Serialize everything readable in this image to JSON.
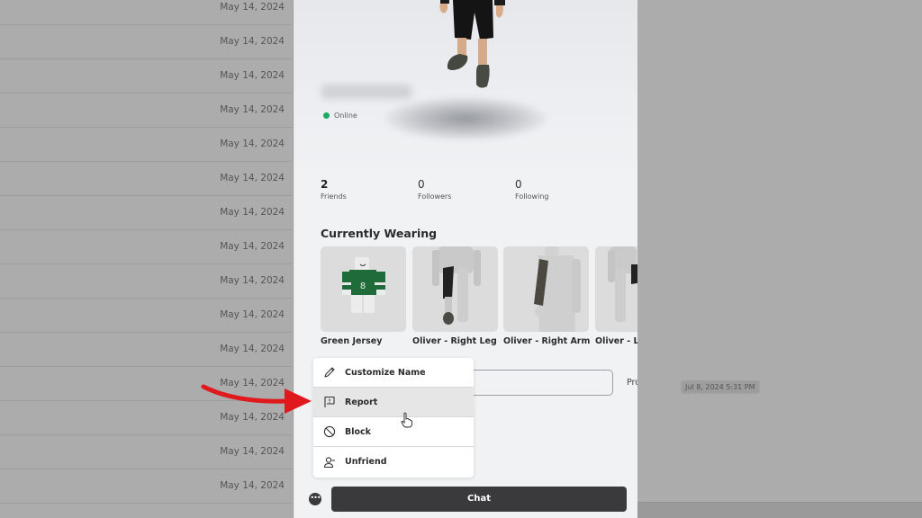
{
  "background_list": {
    "dates": [
      "May 14, 2024",
      "May 14, 2024",
      "May 14, 2024",
      "May 14, 2024",
      "May 14, 2024",
      "May 14, 2024",
      "May 14, 2024",
      "May 14, 2024",
      "May 14, 2024",
      "May 14, 2024",
      "May 14, 2024",
      "May 14, 2024",
      "May 14, 2024",
      "May 14, 2024",
      "May 14, 2024"
    ]
  },
  "timestamp_tooltip": "Jul 8, 2024 5:31 PM",
  "profile": {
    "status": "Online",
    "status_color": "#1fa865",
    "stats": [
      {
        "value": "2",
        "label": "Friends"
      },
      {
        "value": "0",
        "label": "Followers"
      },
      {
        "value": "0",
        "label": "Following"
      }
    ],
    "currently_wearing_title": "Currently Wearing",
    "items": [
      {
        "name": "Green Jersey"
      },
      {
        "name": "Oliver - Right Leg"
      },
      {
        "name": "Oliver - Right Arm"
      },
      {
        "name": "Oliver - Left Leg"
      }
    ],
    "view_profile_label": "Profile",
    "chat_label": "Chat",
    "more_label": "•••"
  },
  "menu": {
    "items": [
      {
        "label": "Customize Name",
        "icon": "pencil-icon"
      },
      {
        "label": "Report",
        "icon": "flag-icon"
      },
      {
        "label": "Block",
        "icon": "block-icon"
      },
      {
        "label": "Unfriend",
        "icon": "unfriend-icon"
      }
    ],
    "hovered_index": 1
  },
  "annotation": {
    "arrow_color": "#e0191c"
  }
}
